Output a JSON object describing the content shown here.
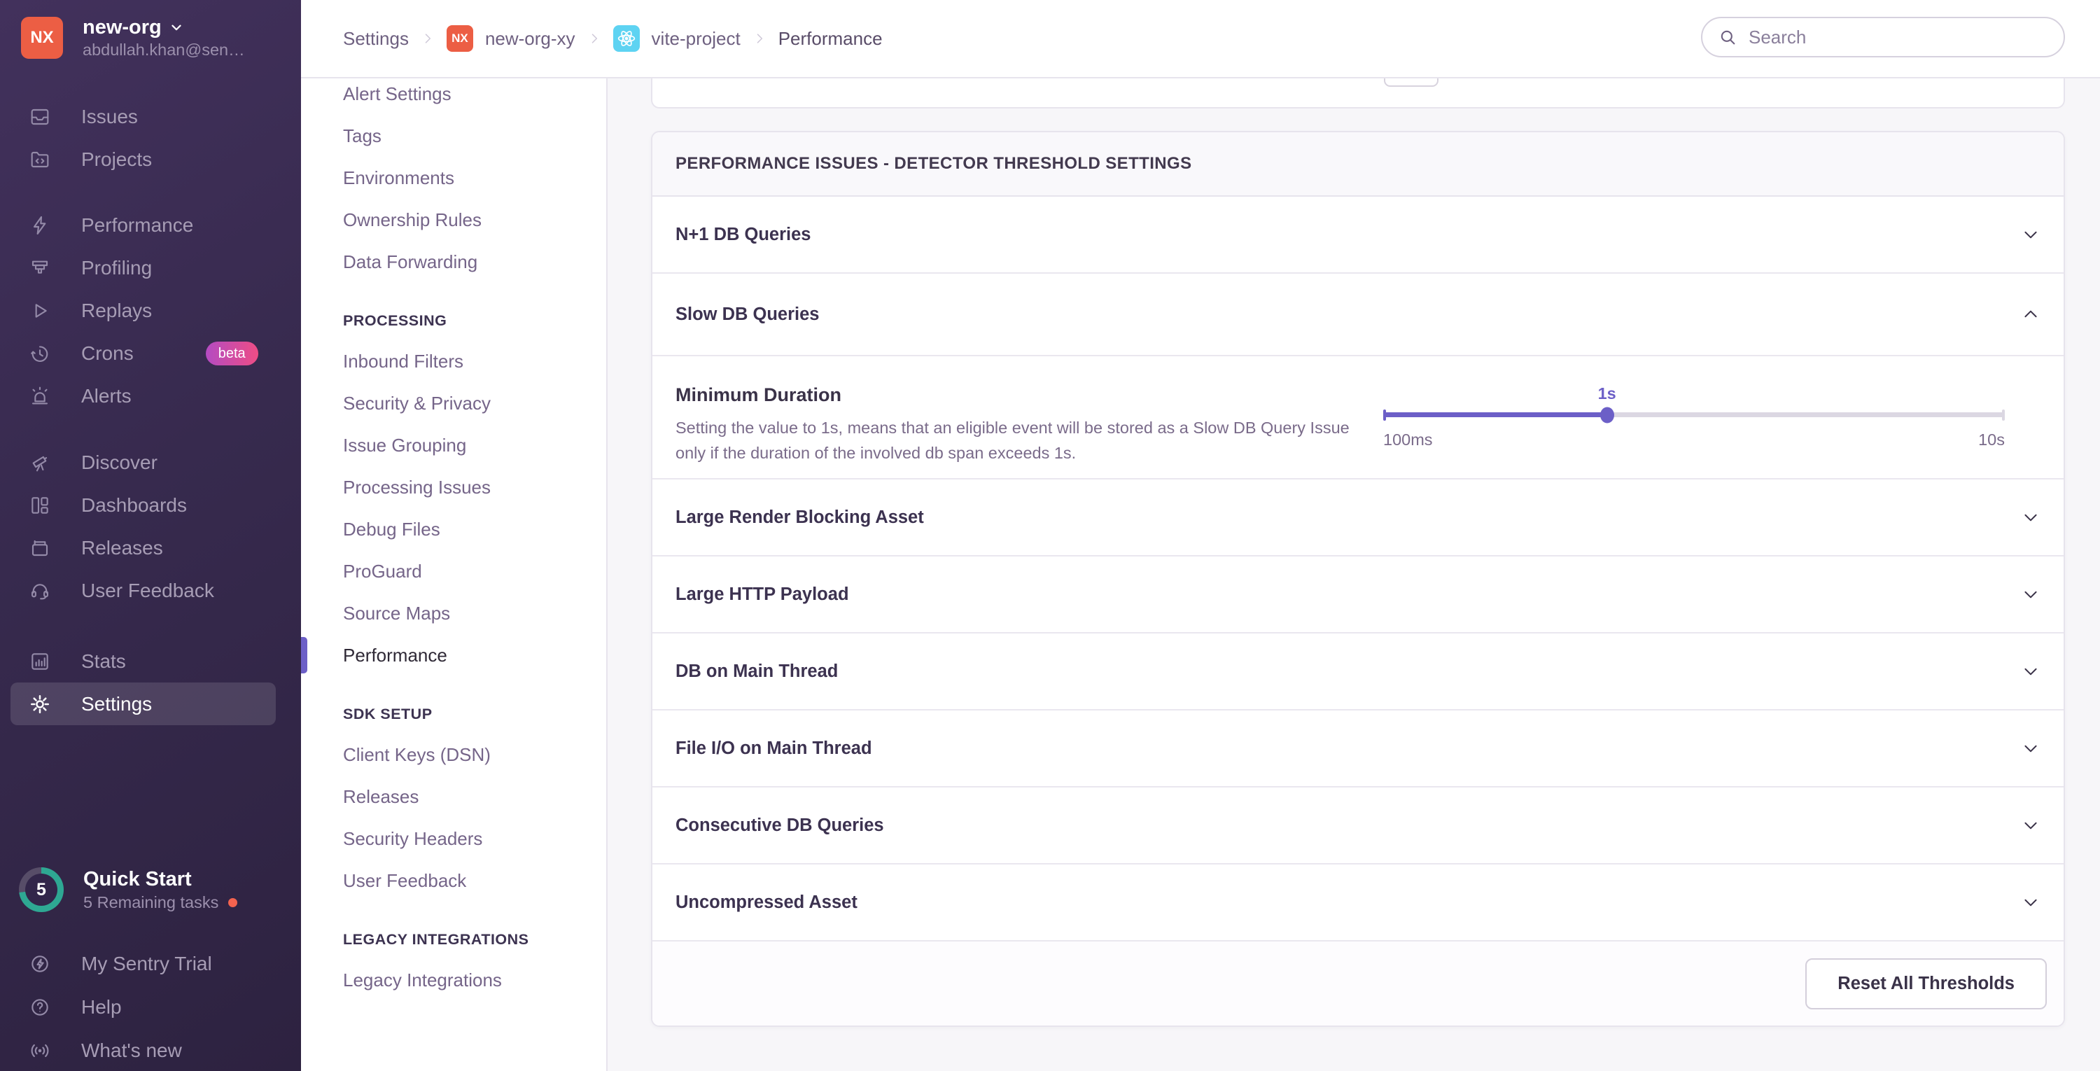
{
  "colors": {
    "accent_purple": "#6C5FC7",
    "org_avatar_bg": "#ec5e44",
    "beta_badge_gradient": [
      "#b44bc2",
      "#ed4d85"
    ],
    "quickstart_ring": "#2ea893",
    "notification_dot": "#f4634f",
    "react_badge_bg": "#5ed3f2",
    "sidebar_bg": "#372a4e"
  },
  "sidebar": {
    "org": {
      "avatar_initials": "NX",
      "name": "new-org",
      "email": "abdullah.khan@sen…"
    },
    "groups": [
      {
        "items": [
          {
            "icon": "issues-icon",
            "label": "Issues"
          },
          {
            "icon": "projects-icon",
            "label": "Projects"
          }
        ]
      },
      {
        "items": [
          {
            "icon": "performance-icon",
            "label": "Performance"
          },
          {
            "icon": "profiling-icon",
            "label": "Profiling"
          },
          {
            "icon": "replays-icon",
            "label": "Replays"
          },
          {
            "icon": "crons-icon",
            "label": "Crons",
            "badge": "beta"
          },
          {
            "icon": "alerts-icon",
            "label": "Alerts"
          }
        ]
      },
      {
        "items": [
          {
            "icon": "discover-icon",
            "label": "Discover"
          },
          {
            "icon": "dashboards-icon",
            "label": "Dashboards"
          },
          {
            "icon": "releases-icon",
            "label": "Releases"
          },
          {
            "icon": "user-feedback-icon",
            "label": "User Feedback"
          }
        ]
      },
      {
        "items": [
          {
            "icon": "stats-icon",
            "label": "Stats"
          },
          {
            "icon": "settings-icon",
            "label": "Settings",
            "active": true
          }
        ]
      }
    ],
    "quick_start": {
      "label": "Quick Start",
      "subtitle": "5 Remaining tasks",
      "count": "5"
    },
    "footer_items": [
      {
        "icon": "trial-icon",
        "label": "My Sentry Trial"
      },
      {
        "icon": "help-icon",
        "label": "Help"
      },
      {
        "icon": "whats-new-icon",
        "label": "What's new"
      }
    ]
  },
  "header": {
    "breadcrumbs": {
      "settings": "Settings",
      "org_initials": "NX",
      "org": "new-org-xy",
      "project": "vite-project",
      "page": "Performance"
    },
    "search_placeholder": "Search"
  },
  "settings_nav": {
    "group1": {
      "items": [
        "Alert Settings",
        "Tags",
        "Environments",
        "Ownership Rules",
        "Data Forwarding"
      ]
    },
    "group2": {
      "header": "PROCESSING",
      "items": [
        "Inbound Filters",
        "Security & Privacy",
        "Issue Grouping",
        "Processing Issues",
        "Debug Files",
        "ProGuard",
        "Source Maps",
        "Performance"
      ],
      "active_item": "Performance"
    },
    "group3": {
      "header": "SDK SETUP",
      "items": [
        "Client Keys (DSN)",
        "Releases",
        "Security Headers",
        "User Feedback"
      ]
    },
    "group4": {
      "header": "LEGACY INTEGRATIONS",
      "items": [
        "Legacy Integrations"
      ]
    }
  },
  "main": {
    "panel_title": "PERFORMANCE ISSUES - DETECTOR THRESHOLD SETTINGS",
    "rows": [
      {
        "label": "N+1 DB Queries",
        "expanded": false
      },
      {
        "label": "Slow DB Queries",
        "expanded": true
      },
      {
        "label": "Large Render Blocking Asset",
        "expanded": false
      },
      {
        "label": "Large HTTP Payload",
        "expanded": false
      },
      {
        "label": "DB on Main Thread",
        "expanded": false
      },
      {
        "label": "File I/O on Main Thread",
        "expanded": false
      },
      {
        "label": "Consecutive DB Queries",
        "expanded": false
      },
      {
        "label": "Uncompressed Asset",
        "expanded": false
      }
    ],
    "slow_db_setting": {
      "label": "Minimum Duration",
      "description": "Setting the value to 1s, means that an eligible event will be stored as a Slow DB Query Issue only if the duration of the involved db span exceeds 1s.",
      "slider": {
        "value_label": "1s",
        "min_label": "100ms",
        "max_label": "10s",
        "percent": 36
      }
    },
    "reset_button": "Reset All Thresholds"
  }
}
